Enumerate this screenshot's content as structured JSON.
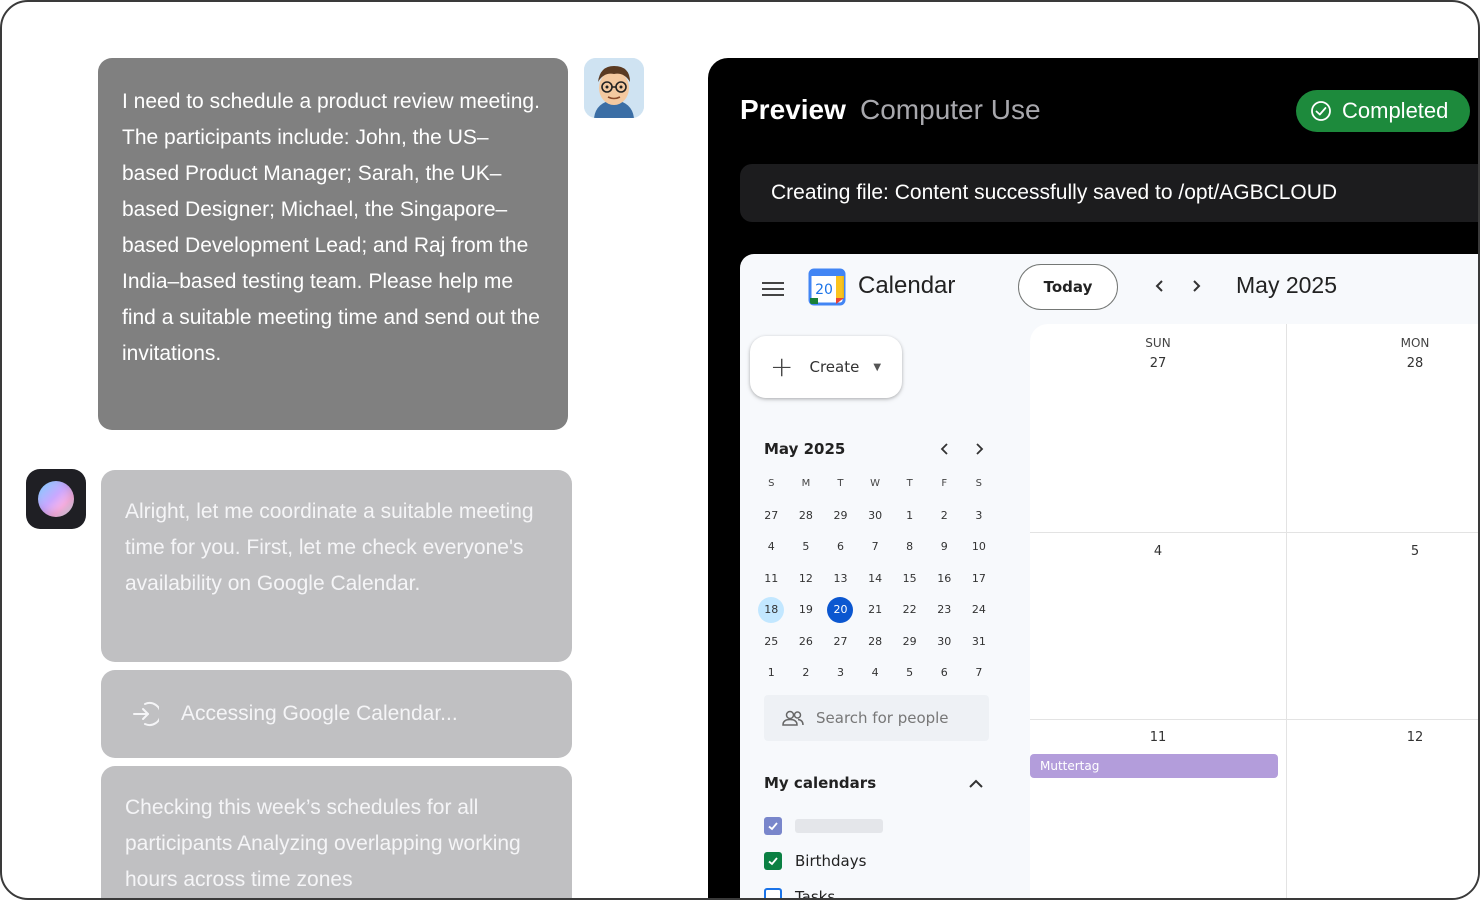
{
  "chat": {
    "user_message": "I need to schedule a product review meeting. The participants include: John, the US–based Product Manager; Sarah, the UK–based Designer; Michael, the Singapore–based Development Lead; and Raj from the India–based testing team. Please help me find a suitable meeting time and send out the invitations.",
    "assistant_message": "Alright, let me coordinate a suitable meeting time for you. First, let me check everyone's availability on Google Calendar.",
    "step_label": "Accessing Google Calendar...",
    "step_detail": "Checking this week’s schedules for all participants Analyzing overlapping working hours across time zones"
  },
  "preview": {
    "title": "Preview",
    "subtitle": "Computer Use",
    "badge": "Completed",
    "status": "Creating file: Content successfully saved to /opt/AGBCLOUD",
    "colors": {
      "badge": "#1d8a3c",
      "panel": "#000000"
    }
  },
  "calendar": {
    "app_name": "Calendar",
    "logo_day": "20",
    "today_button": "Today",
    "month_label": "May 2025",
    "create_label": "Create",
    "mini": {
      "month": "May 2025",
      "dow": [
        "S",
        "M",
        "T",
        "W",
        "T",
        "F",
        "S"
      ],
      "weeks": [
        [
          "27",
          "28",
          "29",
          "30",
          "1",
          "2",
          "3"
        ],
        [
          "4",
          "5",
          "6",
          "7",
          "8",
          "9",
          "10"
        ],
        [
          "11",
          "12",
          "13",
          "14",
          "15",
          "16",
          "17"
        ],
        [
          "18",
          "19",
          "20",
          "21",
          "22",
          "23",
          "24"
        ],
        [
          "25",
          "26",
          "27",
          "28",
          "29",
          "30",
          "31"
        ],
        [
          "1",
          "2",
          "3",
          "4",
          "5",
          "6",
          "7"
        ]
      ],
      "selected": "18",
      "current": "20"
    },
    "search_people": "Search for people",
    "my_calendars": "My calendars",
    "calendars": [
      {
        "label": "",
        "checked": true,
        "color": "#7986cb"
      },
      {
        "label": "Birthdays",
        "checked": true,
        "color": "#0b8043"
      },
      {
        "label": "Tasks",
        "checked": false,
        "color": "#1a73e8"
      }
    ],
    "days": [
      {
        "dow": "SUN",
        "date": "27"
      },
      {
        "dow": "MON",
        "date": "28"
      }
    ],
    "week2": [
      "4",
      "5"
    ],
    "week3": [
      "11",
      "12"
    ],
    "event": {
      "label": "Muttertag",
      "color": "#b39ddb"
    }
  }
}
